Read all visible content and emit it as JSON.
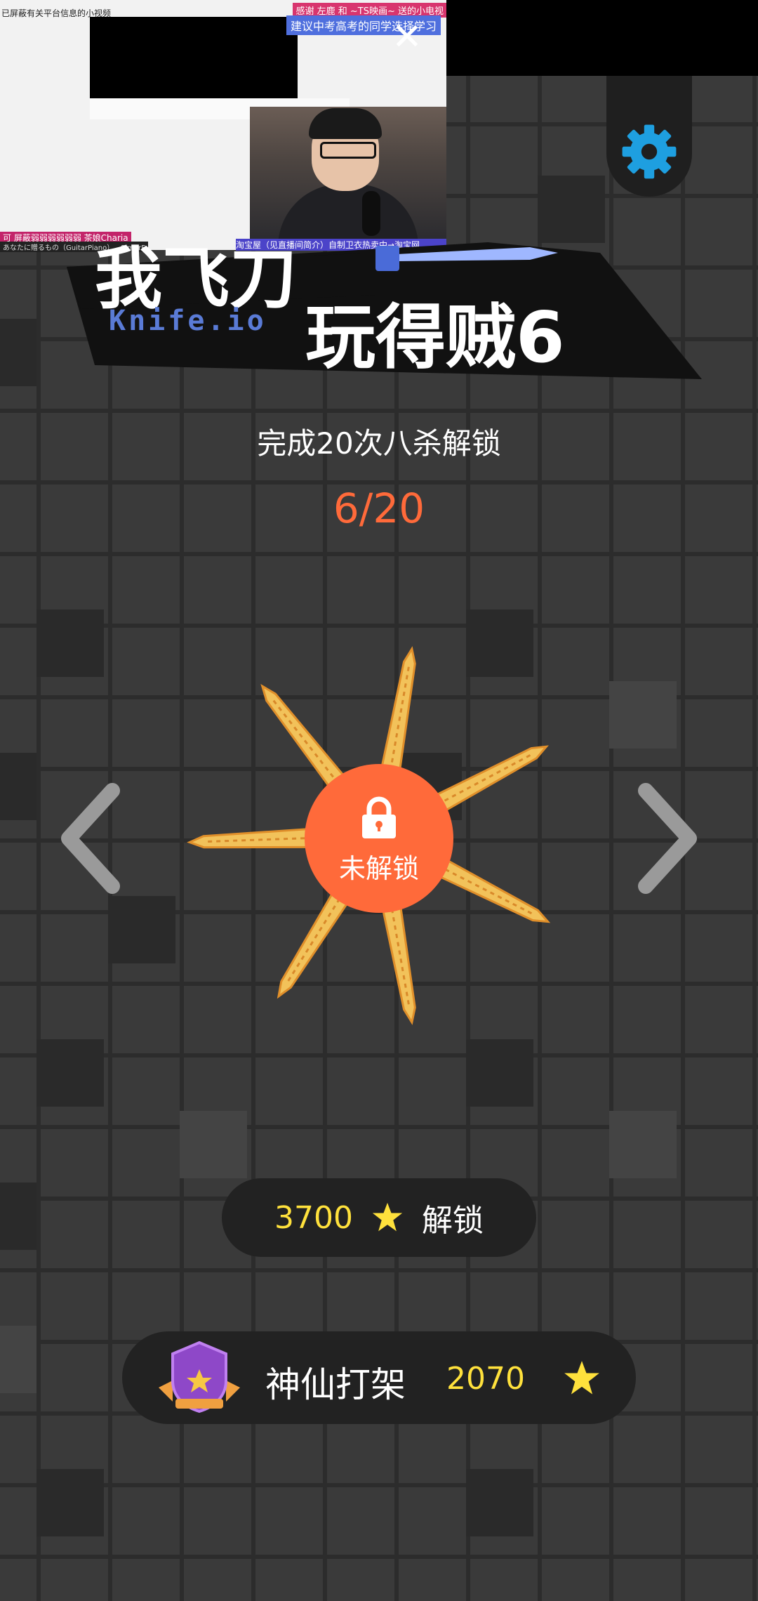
{
  "stream_overlay": {
    "top_left_text": "已屏蔽有关平台信息的小视频",
    "thanks_text": "感谢 左鹿 和 ~TS映画~ 送的小电视",
    "suggest_text": "建议中考高考的同学选择学习",
    "bar_left_top": "可 屏蔽弱弱弱弱弱弱 茶娘Charia",
    "bar_left_bottom": "あなたに贈るもの（GuitarPiano） - SimorF",
    "bar_right": "淘宝屋（见直播间简介）自制卫衣热卖中→淘宝网"
  },
  "logo": {
    "title_top": "我飞刀",
    "subtitle": "Knife.io",
    "title_bottom": "玩得贼6"
  },
  "unlock_hint": "完成20次八杀解锁",
  "progress": "6/20",
  "center_button": {
    "label": "未解锁"
  },
  "unlock_button": {
    "cost": "3700",
    "label": "解锁"
  },
  "rank": {
    "title": "神仙打架",
    "score": "2070"
  },
  "colors": {
    "accent_orange": "#ff6a3a",
    "star_yellow": "#ffe13c",
    "gear_blue": "#1e9fe0"
  },
  "icons": [
    "gear-icon",
    "lock-icon",
    "chevron-left-icon",
    "chevron-right-icon",
    "star-icon",
    "rank-shield-icon"
  ]
}
